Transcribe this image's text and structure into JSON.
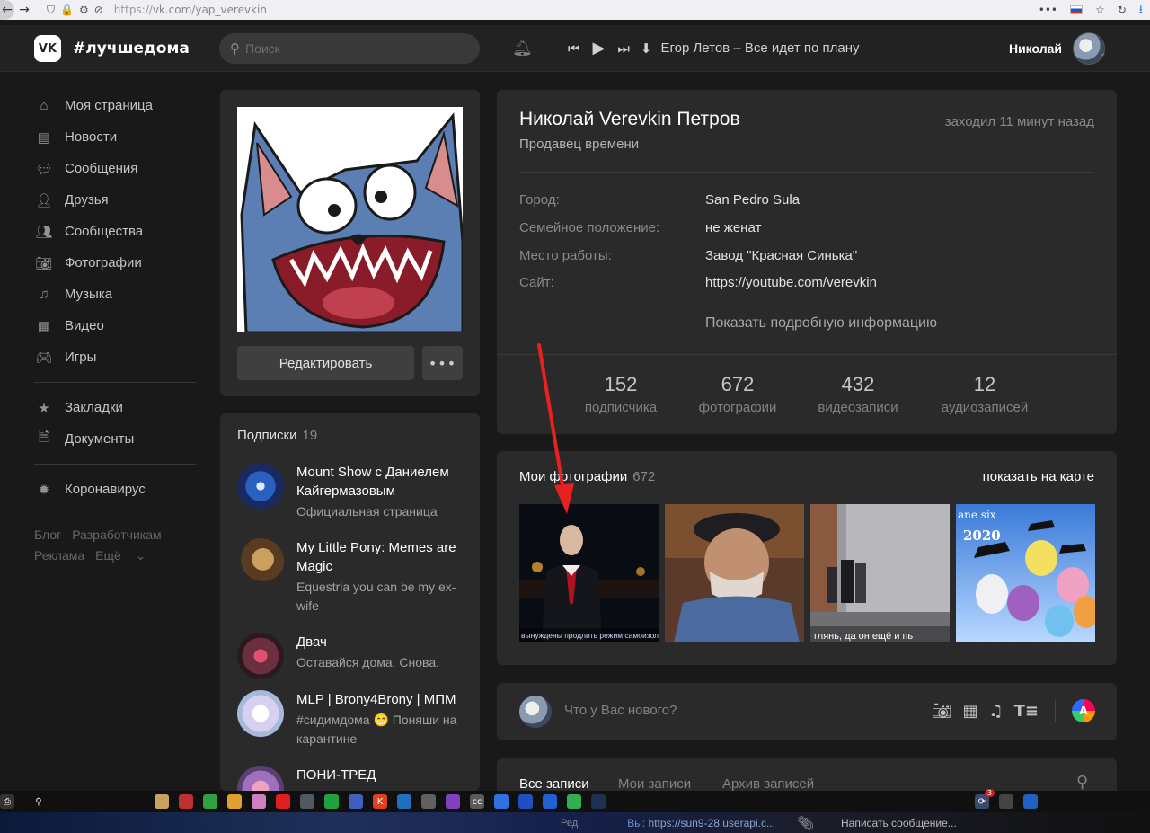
{
  "browser": {
    "url_prefix": "https://",
    "url_host": "vk.com/yap_verevkin"
  },
  "header": {
    "logo": "VK",
    "brand": "#лучшедома",
    "search_placeholder": "Поиск",
    "track": "Егор Летов – Все идет по плану",
    "user_name": "Николай"
  },
  "menu": {
    "items": [
      {
        "label": "Моя страница",
        "icon": "home-icon"
      },
      {
        "label": "Новости",
        "icon": "news-icon"
      },
      {
        "label": "Сообщения",
        "icon": "messages-icon"
      },
      {
        "label": "Друзья",
        "icon": "friends-icon"
      },
      {
        "label": "Сообщества",
        "icon": "communities-icon"
      },
      {
        "label": "Фотографии",
        "icon": "camera-icon"
      },
      {
        "label": "Музыка",
        "icon": "music-icon"
      },
      {
        "label": "Видео",
        "icon": "video-icon"
      },
      {
        "label": "Игры",
        "icon": "games-icon"
      }
    ],
    "items2": [
      {
        "label": "Закладки",
        "icon": "star-icon"
      },
      {
        "label": "Документы",
        "icon": "document-icon"
      }
    ],
    "items3": [
      {
        "label": "Коронавирус",
        "icon": "virus-icon"
      }
    ],
    "footer": {
      "blog": "Блог",
      "dev": "Разработчикам",
      "ads": "Реклама",
      "more": "Ещё"
    }
  },
  "profile": {
    "edit_label": "Редактировать",
    "more_label": "•••",
    "name": "Николай Verevkin Петров",
    "status": "Продавец времени",
    "online": "заходил 11 минут назад",
    "info": [
      {
        "label": "Город:",
        "value": "San Pedro Sula"
      },
      {
        "label": "Семейное положение:",
        "value": "не женат"
      },
      {
        "label": "Место работы:",
        "value": "Завод \"Красная Синька\""
      },
      {
        "label": "Сайт:",
        "value": "https://youtube.com/verevkin"
      }
    ],
    "more_info": "Показать подробную информацию",
    "counters": [
      {
        "num": "152",
        "label": "подписчика"
      },
      {
        "num": "672",
        "label": "фотографии"
      },
      {
        "num": "432",
        "label": "видеозаписи"
      },
      {
        "num": "12",
        "label": "аудиозаписей"
      }
    ]
  },
  "subscriptions": {
    "title": "Подписки",
    "count": "19",
    "items": [
      {
        "name": "Mount Show с Даниелем Кайгермазовым",
        "desc": "Официальная страница"
      },
      {
        "name": "My Little Pony: Memes are Magic",
        "desc": "Equestria you can be my ex-wife"
      },
      {
        "name": "Двач",
        "desc": "Оставайся дома. Снова."
      },
      {
        "name": "MLP | Brony4Brony | МПМ",
        "desc": "#сидимдома 😁 Поняши на карантине"
      },
      {
        "name": "ПОНИ-ТРЕД",
        "desc": ""
      }
    ]
  },
  "photos": {
    "title": "Мои фотографии",
    "count": "672",
    "map_link": "показать на карте",
    "captions": [
      "вынуждены продлить режим самоизоляции",
      "",
      "глянь, да он ещё и пь",
      "ane six 2020"
    ]
  },
  "post": {
    "placeholder": "Что у Вас нового?",
    "a_label": "A"
  },
  "wall": {
    "tabs": [
      "Все записи",
      "Мои записи",
      "Архив записей"
    ]
  },
  "taskbar": {
    "badge": "3",
    "red_label": "Ред.",
    "msg_prefix": "Вы:",
    "msg_text": "https://sun9-28.userapi.c...",
    "write_label": "Написать сообщение..."
  },
  "colors": {
    "bg": "#19191a",
    "card": "#2a2a2b",
    "header": "#222222",
    "arrow": "#e8201f"
  }
}
